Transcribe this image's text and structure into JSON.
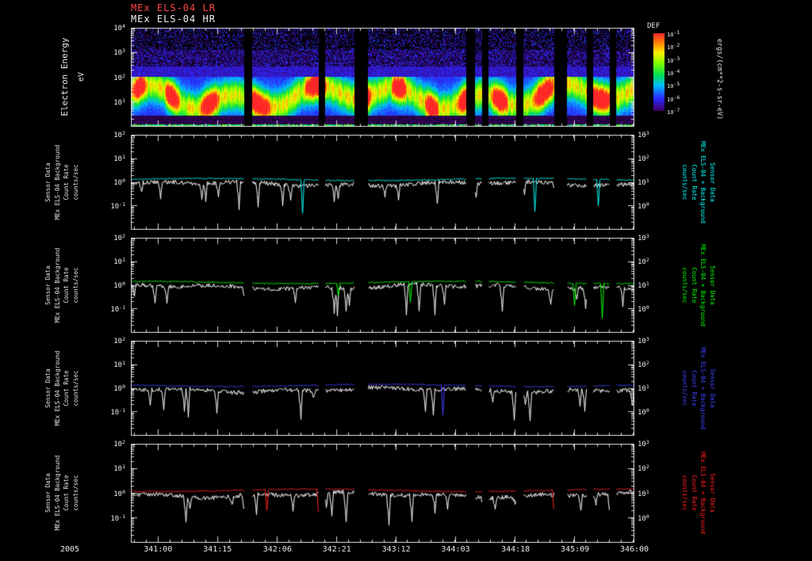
{
  "chart_data": {
    "titles": [
      {
        "text": "MEx ELS-04 LR",
        "color": "#ff4444"
      },
      {
        "text": "MEx ELS-04 HR",
        "color": "#f0f0f0"
      }
    ],
    "x_axis": {
      "year": "2005",
      "unit": "day:hour",
      "tick_labels": [
        "341:00",
        "341:15",
        "342:06",
        "342:21",
        "343:12",
        "344:03",
        "344:18",
        "345:09",
        "346:00"
      ],
      "tick_fracs": [
        0.054,
        0.172,
        0.291,
        0.409,
        0.527,
        0.645,
        0.764,
        0.882,
        1.0
      ]
    },
    "gaps": [
      [
        0.225,
        0.24
      ],
      [
        0.372,
        0.385
      ],
      [
        0.443,
        0.47
      ],
      [
        0.665,
        0.682
      ],
      [
        0.697,
        0.71
      ],
      [
        0.764,
        0.778
      ],
      [
        0.84,
        0.866
      ],
      [
        0.905,
        0.917
      ],
      [
        0.95,
        0.963
      ]
    ],
    "spectrogram": {
      "type": "heatmap",
      "ylabel_main": "Electron Energy",
      "ylabel_sub": "eV",
      "y_range_eV": [
        1,
        10000
      ],
      "y_tick_exponents": [
        4,
        3,
        2,
        1
      ],
      "bright_band_eV": [
        5,
        100
      ],
      "flux_range_ergs": [
        1e-07,
        0.1
      ],
      "seed": 1337,
      "description": "Electron differential energy flux vs time; bright 5-100 eV band with quasi-periodic enhancements; black vertical data-gap columns"
    },
    "colorbar": {
      "title": "DEF",
      "units": "ergs/(cm**2-s-sr-eV)",
      "tick_exponents": [
        -1,
        -2,
        -3,
        -4,
        -5,
        -6,
        -7
      ]
    },
    "line_panels": [
      {
        "type": "line",
        "color": "#00ffff",
        "seed": 11,
        "left_label": "Sensor Data\nMEx ELS-04 Background\nCount Rate\ncounts/sec",
        "right_label": "Sensor Data\nMEx ELS-04 + Background\nCount Rate\ncounts/sec",
        "left_tick_exponents": [
          2,
          1,
          0,
          -1
        ],
        "right_tick_exponents": [
          3,
          2,
          1,
          0
        ],
        "y_range_counts_per_sec": [
          0.01,
          100
        ],
        "series": [
          {
            "name": "MEx ELS-04 + Background Count Rate (LR)",
            "color": "#00ffff",
            "baseline_counts_per_sec": 1.3
          },
          {
            "name": "Sensor Data Count Rate (LR)",
            "color": "#ffffff",
            "baseline_counts_per_sec": 0.85,
            "dips_to": 0.05
          }
        ]
      },
      {
        "type": "line",
        "color": "#00ff00",
        "seed": 22,
        "left_label": "Sensor Data\nMEx ELS-04 Background\nCount Rate\ncounts/sec",
        "right_label": "Sensor Data\nMEx ELS-04 + Background\nCount Rate\ncounts/sec",
        "left_tick_exponents": [
          2,
          1,
          0,
          -1
        ],
        "right_tick_exponents": [
          3,
          2,
          1,
          0
        ],
        "y_range_counts_per_sec": [
          0.01,
          100
        ],
        "series": [
          {
            "name": "MEx ELS-04 + Background Count Rate",
            "color": "#00ff00",
            "baseline_counts_per_sec": 1.3
          },
          {
            "name": "Sensor Data Count Rate",
            "color": "#ffffff",
            "baseline_counts_per_sec": 0.85,
            "dips_to": 0.05
          }
        ]
      },
      {
        "type": "line",
        "color": "#4040ff",
        "seed": 33,
        "left_label": "Sensor Data\nMEx ELS-04 Background\nCount Rate\ncounts/sec",
        "right_label": "Sensor Data\nMEx ELS-04 + Background\nCount Rate\ncounts/sec",
        "left_tick_exponents": [
          2,
          1,
          0,
          -1
        ],
        "right_tick_exponents": [
          3,
          2,
          1,
          0
        ],
        "y_range_counts_per_sec": [
          0.01,
          100
        ],
        "series": [
          {
            "name": "MEx ELS-04 + Background Count Rate",
            "color": "#4040ff",
            "baseline_counts_per_sec": 1.2
          },
          {
            "name": "Sensor Data Count Rate",
            "color": "#ffffff",
            "baseline_counts_per_sec": 0.85,
            "dips_to": 0.05
          }
        ]
      },
      {
        "type": "line",
        "color": "#ff2020",
        "seed": 44,
        "left_label": "Sensor Data\nMEx ELS-04 Background\nCount Rate\ncounts/sec",
        "right_label": "Sensor Data\nMEx ELS-04 + Background\nCount Rate\ncounts/sec",
        "left_tick_exponents": [
          2,
          1,
          0,
          -1
        ],
        "right_tick_exponents": [
          3,
          2,
          1,
          0
        ],
        "y_range_counts_per_sec": [
          0.01,
          100
        ],
        "series": [
          {
            "name": "MEx ELS-04 + Background Count Rate (HR)",
            "color": "#ff2020",
            "baseline_counts_per_sec": 1.3
          },
          {
            "name": "Sensor Data Count Rate (HR)",
            "color": "#ffffff",
            "baseline_counts_per_sec": 0.85,
            "dips_to": 0.05
          }
        ]
      }
    ]
  }
}
